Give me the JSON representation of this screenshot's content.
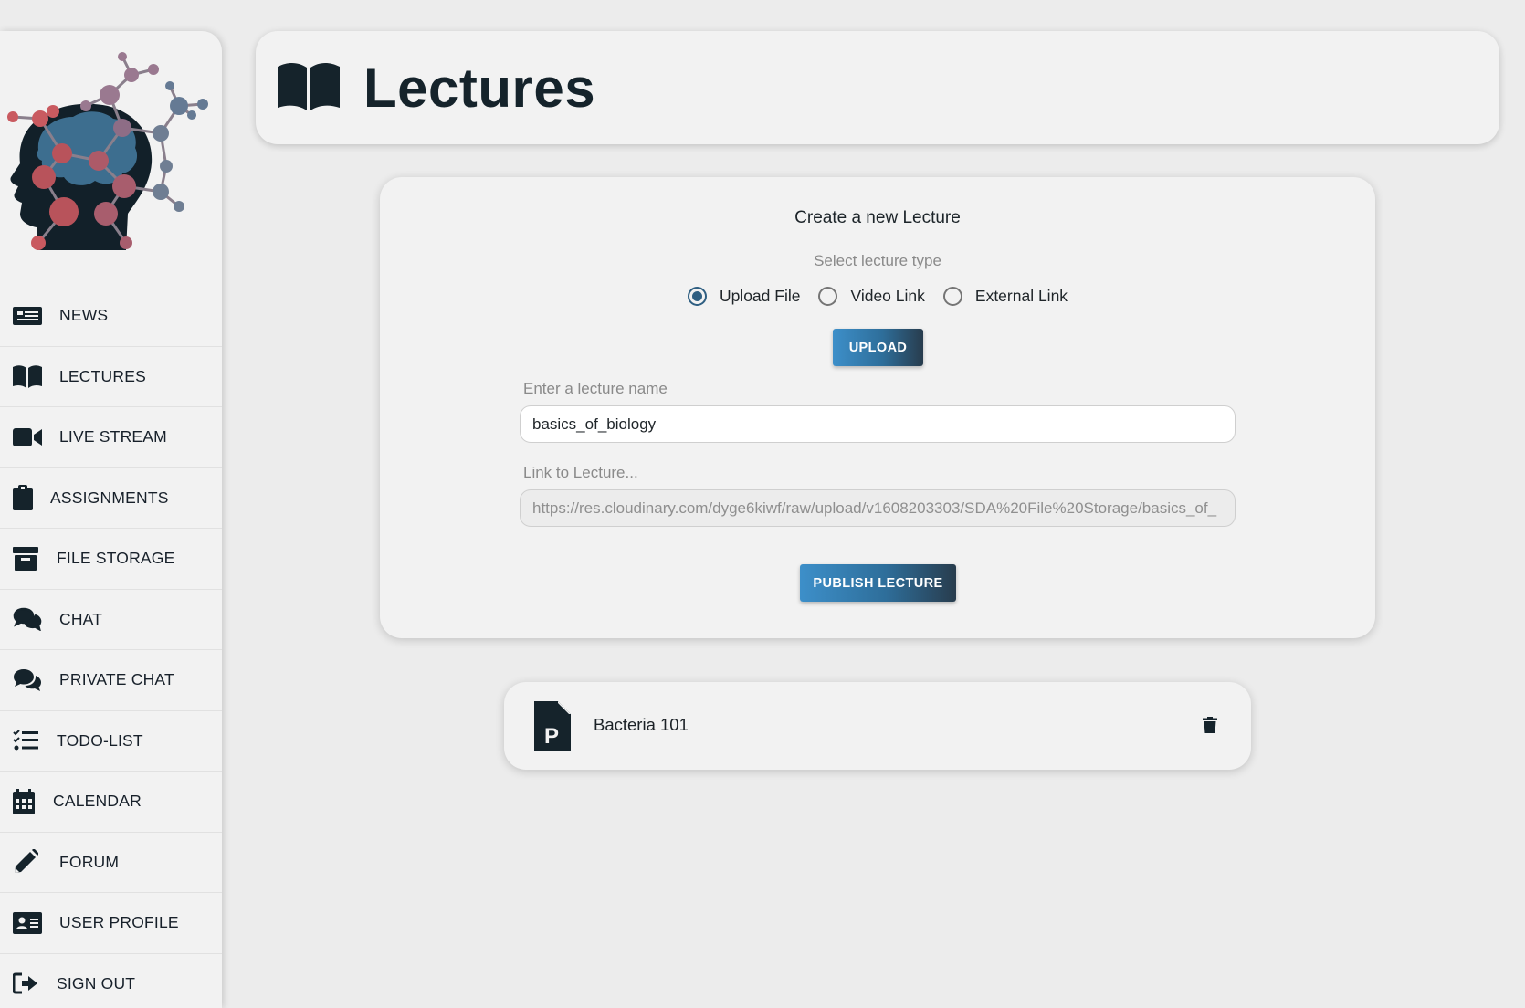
{
  "sidebar": {
    "items": [
      {
        "label": "NEWS",
        "icon": "newspaper-icon"
      },
      {
        "label": "LECTURES",
        "icon": "book-icon"
      },
      {
        "label": "LIVE STREAM",
        "icon": "video-camera-icon"
      },
      {
        "label": "ASSIGNMENTS",
        "icon": "clipboard-icon"
      },
      {
        "label": "FILE STORAGE",
        "icon": "archive-box-icon"
      },
      {
        "label": "CHAT",
        "icon": "chat-bubbles-icon"
      },
      {
        "label": "PRIVATE CHAT",
        "icon": "chat-bubbles-filled-icon"
      },
      {
        "label": "TODO-LIST",
        "icon": "checklist-icon"
      },
      {
        "label": "CALENDAR",
        "icon": "calendar-icon"
      },
      {
        "label": "FORUM",
        "icon": "pencil-icon"
      },
      {
        "label": "USER PROFILE",
        "icon": "id-card-icon"
      },
      {
        "label": "SIGN OUT",
        "icon": "sign-out-icon"
      }
    ]
  },
  "header": {
    "title": "Lectures",
    "icon": "open-book-icon"
  },
  "create_form": {
    "title": "Create a new Lecture",
    "type_prompt": "Select lecture type",
    "types": [
      {
        "label": "Upload File",
        "checked": true
      },
      {
        "label": "Video Link",
        "checked": false
      },
      {
        "label": "External Link",
        "checked": false
      }
    ],
    "upload_label": "UPLOAD",
    "name_label": "Enter a lecture name",
    "name_value": "basics_of_biology",
    "link_label": "Link to Lecture...",
    "link_value": "https://res.cloudinary.com/dyge6kiwf/raw/upload/v1608203303/SDA%20File%20Storage/basics_of_",
    "publish_label": "PUBLISH LECTURE"
  },
  "lectures": [
    {
      "name": "Bacteria 101",
      "icon": "file-powerpoint-icon",
      "action_icon": "trash-icon"
    }
  ],
  "colors": {
    "background": "#ececec",
    "panel": "#f2f2f2",
    "navy": "#15232b",
    "button_gradient_start": "#3d8fc9",
    "button_gradient_end": "#283c4d",
    "radio_accent": "#2f5f82"
  }
}
